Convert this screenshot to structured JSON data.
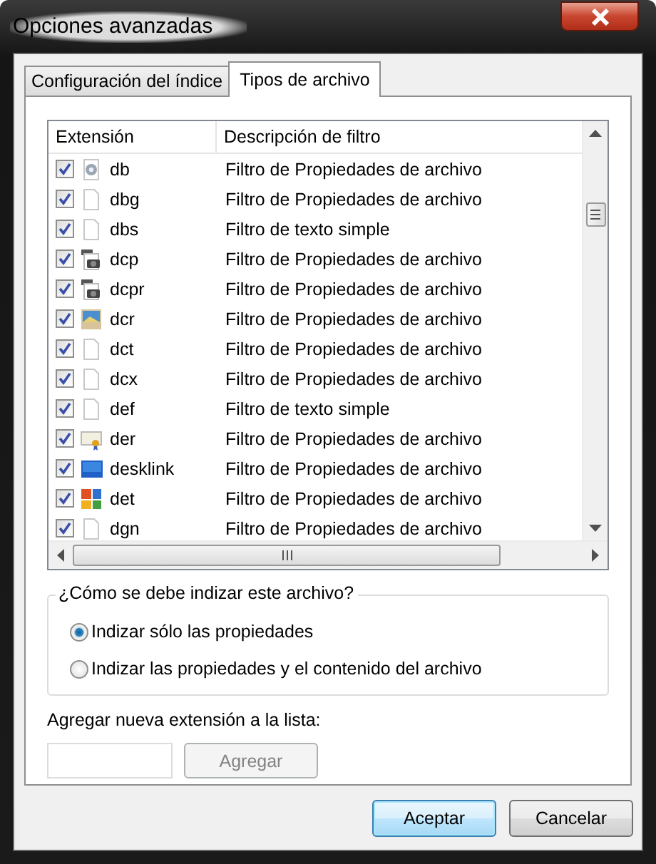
{
  "window": {
    "title": "Opciones avanzadas"
  },
  "tabs": [
    {
      "label": "Configuración del índice",
      "selected": false
    },
    {
      "label": "Tipos de archivo",
      "selected": true
    }
  ],
  "table": {
    "columns": [
      "Extensión",
      "Descripción de filtro"
    ],
    "rows": [
      {
        "checked": true,
        "kind": "gear",
        "extension": "db",
        "description": "Filtro de Propiedades de archivo"
      },
      {
        "checked": true,
        "kind": "blank",
        "extension": "dbg",
        "description": "Filtro de Propiedades de archivo"
      },
      {
        "checked": true,
        "kind": "blank",
        "extension": "dbs",
        "description": "Filtro de texto simple"
      },
      {
        "checked": true,
        "kind": "camera",
        "extension": "dcp",
        "description": "Filtro de Propiedades de archivo"
      },
      {
        "checked": true,
        "kind": "camera",
        "extension": "dcpr",
        "description": "Filtro de Propiedades de archivo"
      },
      {
        "checked": true,
        "kind": "image",
        "extension": "dcr",
        "description": "Filtro de Propiedades de archivo"
      },
      {
        "checked": true,
        "kind": "blank",
        "extension": "dct",
        "description": "Filtro de Propiedades de archivo"
      },
      {
        "checked": true,
        "kind": "blank",
        "extension": "dcx",
        "description": "Filtro de Propiedades de archivo"
      },
      {
        "checked": true,
        "kind": "blank",
        "extension": "def",
        "description": "Filtro de texto simple"
      },
      {
        "checked": true,
        "kind": "certificate",
        "extension": "der",
        "description": "Filtro de Propiedades de archivo"
      },
      {
        "checked": true,
        "kind": "desktop",
        "extension": "desklink",
        "description": "Filtro de Propiedades de archivo"
      },
      {
        "checked": true,
        "kind": "office",
        "extension": "det",
        "description": "Filtro de Propiedades de archivo"
      },
      {
        "checked": true,
        "kind": "blank",
        "extension": "dgn",
        "description": "Filtro de Propiedades de archivo"
      }
    ]
  },
  "index_group": {
    "title": "¿Cómo se debe indizar este archivo?",
    "options": [
      {
        "label": "Indizar sólo las propiedades",
        "selected": true
      },
      {
        "label": "Indizar las propiedades y el contenido del archivo",
        "selected": false
      }
    ]
  },
  "add_extension": {
    "label": "Agregar nueva extensión a la lista:",
    "button": {
      "label": "Agregar",
      "disabled": true
    }
  },
  "buttons": [
    {
      "label": "Aceptar",
      "default": true
    },
    {
      "label": "Cancelar",
      "default": false
    }
  ]
}
